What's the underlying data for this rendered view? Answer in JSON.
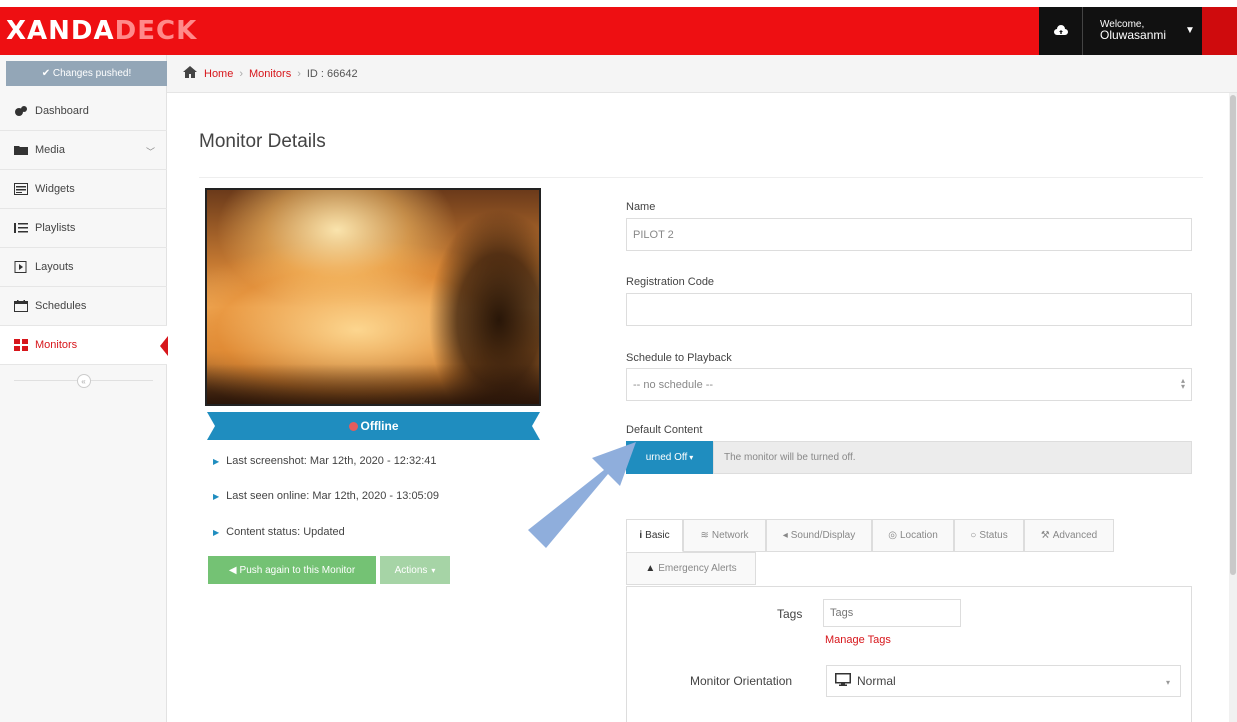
{
  "brand": {
    "part1": "XANDA",
    "part2": "DECK"
  },
  "header": {
    "welcome": "Welcome,",
    "username": "Oluwasanmi",
    "cloud_icon": "cloud-upload-icon"
  },
  "sidebar": {
    "status": "✔ Changes pushed!",
    "items": [
      {
        "label": "Dashboard",
        "icon": "dashboard-icon"
      },
      {
        "label": "Media",
        "icon": "folder-icon"
      },
      {
        "label": "Widgets",
        "icon": "widget-icon"
      },
      {
        "label": "Playlists",
        "icon": "list-icon"
      },
      {
        "label": "Layouts",
        "icon": "layout-icon"
      },
      {
        "label": "Schedules",
        "icon": "calendar-icon"
      },
      {
        "label": "Monitors",
        "icon": "monitors-icon",
        "active": true
      }
    ]
  },
  "breadcrumb": {
    "home": "Home",
    "monitors": "Monitors",
    "id": "ID : 66642"
  },
  "page": {
    "title": "Monitor Details"
  },
  "monitor": {
    "status": "Offline",
    "last_screenshot": "Last screenshot: Mar 12th, 2020 - 12:32:41",
    "last_seen": "Last seen online: Mar 12th, 2020 - 13:05:09",
    "content_status": "Content status: Updated",
    "push_button": "Push again to this Monitor",
    "actions_button": "Actions"
  },
  "form": {
    "name_label": "Name",
    "name_value": "PILOT 2",
    "reg_label": "Registration Code",
    "reg_value": "",
    "schedule_label": "Schedule to Playback",
    "schedule_value": "-- no schedule --",
    "default_label": "Default Content",
    "default_button": "urned Off",
    "default_message": "The monitor will be turned off."
  },
  "tabs": [
    {
      "label": "Basic",
      "icon": "info-icon",
      "active": true
    },
    {
      "label": "Network",
      "icon": "wifi-icon"
    },
    {
      "label": "Sound/Display",
      "icon": "speaker-icon"
    },
    {
      "label": "Location",
      "icon": "location-icon"
    },
    {
      "label": "Status",
      "icon": "status-icon"
    },
    {
      "label": "Advanced",
      "icon": "wrench-icon"
    },
    {
      "label": "Emergency Alerts",
      "icon": "warning-icon"
    }
  ],
  "basic": {
    "tags_label": "Tags",
    "tags_placeholder": "Tags",
    "manage_tags": "Manage Tags",
    "orientation_label": "Monitor Orientation",
    "orientation_value": "Normal"
  },
  "colors": {
    "brand_red": "#ee0f12",
    "accent_blue": "#1f8dbf",
    "green": "#5cb85c",
    "annotation_arrow": "#8faedc"
  }
}
